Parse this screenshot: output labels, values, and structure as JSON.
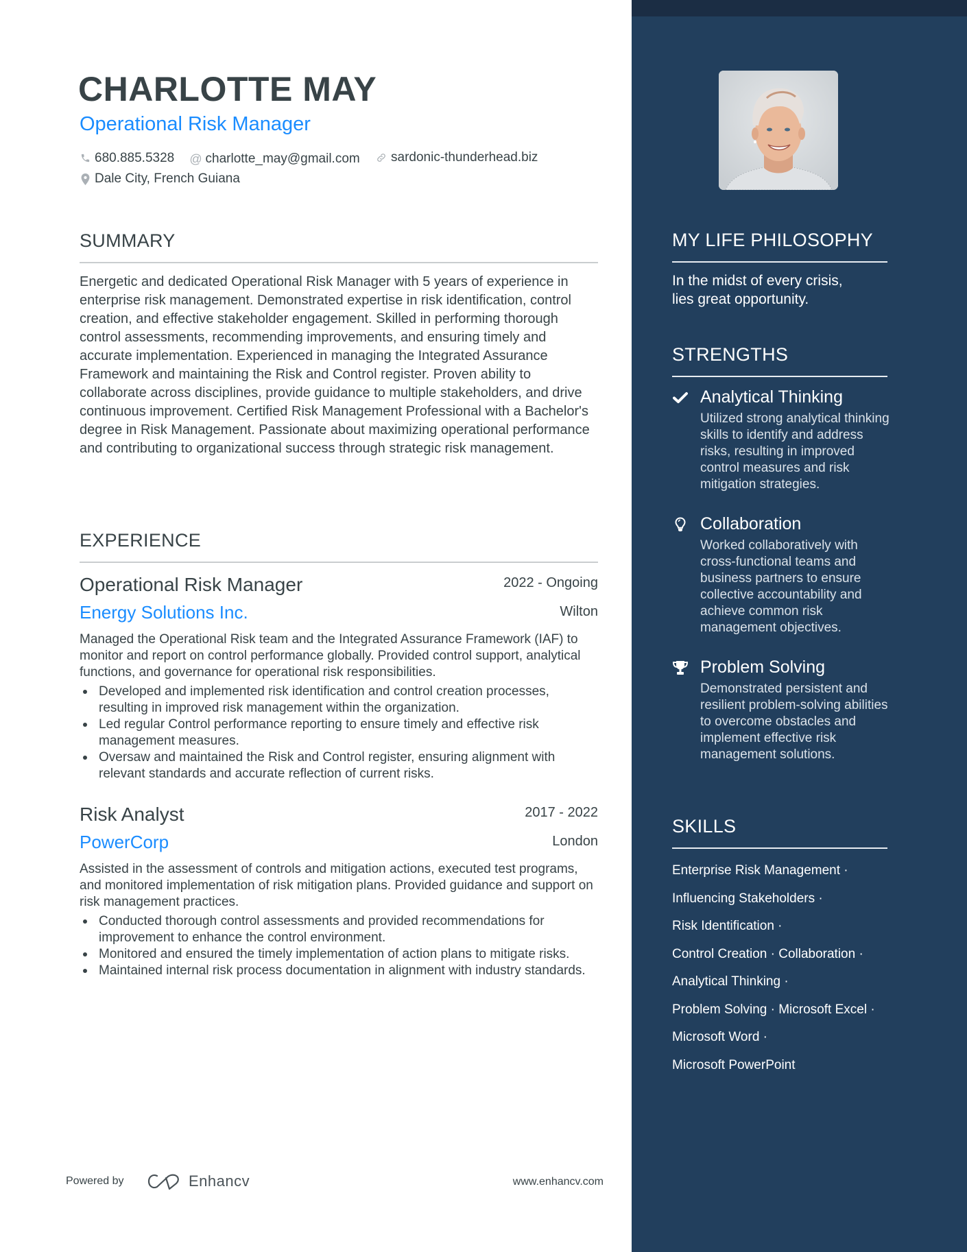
{
  "header": {
    "name": "CHARLOTTE MAY",
    "title": "Operational Risk Manager",
    "contacts": {
      "phone": "680.885.5328",
      "email": "charlotte_may@gmail.com",
      "website": "sardonic-thunderhead.biz",
      "location": "Dale City, French Guiana"
    }
  },
  "summary": {
    "heading": "SUMMARY",
    "text": "Energetic and dedicated Operational Risk Manager with 5 years of experience in enterprise risk management. Demonstrated expertise in risk identification, control creation, and effective stakeholder engagement. Skilled in performing thorough control assessments, recommending improvements, and ensuring timely and accurate implementation. Experienced in managing the Integrated Assurance Framework and maintaining the Risk and Control register. Proven ability to collaborate across disciplines, provide guidance to multiple stakeholders, and drive continuous improvement. Certified Risk Management Professional with a Bachelor's degree in Risk Management. Passionate about maximizing operational performance and contributing to organizational success through strategic risk management."
  },
  "experience": {
    "heading": "EXPERIENCE",
    "jobs": [
      {
        "title": "Operational Risk Manager",
        "dates": "2022 - Ongoing",
        "company": "Energy Solutions Inc.",
        "location": "Wilton",
        "description": "Managed the Operational Risk team and the Integrated Assurance Framework (IAF) to monitor and report on control performance globally. Provided control support, analytical functions, and governance for operational risk responsibilities.",
        "bullets": [
          "Developed and implemented risk identification and control creation processes, resulting in improved risk management within the organization.",
          "Led regular Control performance reporting to ensure timely and effective risk management measures.",
          "Oversaw and maintained the Risk and Control register, ensuring alignment with relevant standards and accurate reflection of current risks."
        ]
      },
      {
        "title": "Risk Analyst",
        "dates": "2017 - 2022",
        "company": "PowerCorp",
        "location": "London",
        "description": "Assisted in the assessment of controls and mitigation actions, executed test programs, and monitored implementation of risk mitigation plans. Provided guidance and support on risk management practices.",
        "bullets": [
          "Conducted thorough control assessments and provided recommendations for improvement to enhance the control environment.",
          "Monitored and ensured the timely implementation of action plans to mitigate risks.",
          "Maintained internal risk process documentation in alignment with industry standards."
        ]
      }
    ]
  },
  "sidebar": {
    "philosophy": {
      "heading": "MY LIFE PHILOSOPHY",
      "quote_line1": "In the midst of every crisis,",
      "quote_line2": "lies great opportunity."
    },
    "strengths": {
      "heading": "STRENGTHS",
      "items": [
        {
          "icon": "check-icon",
          "title": "Analytical Thinking",
          "description": "Utilized strong analytical thinking skills to identify and address risks, resulting in improved control measures and risk mitigation strategies."
        },
        {
          "icon": "lightbulb-icon",
          "title": "Collaboration",
          "description": "Worked collaboratively with cross-functional teams and business partners to ensure collective accountability and achieve common risk management objectives."
        },
        {
          "icon": "trophy-icon",
          "title": "Problem Solving",
          "description": "Demonstrated persistent and resilient problem-solving abilities to overcome obstacles and implement effective risk management solutions."
        }
      ]
    },
    "skills": {
      "heading": "SKILLS",
      "lines": [
        "Enterprise Risk Management ·",
        "Influencing Stakeholders ·",
        "Risk Identification ·",
        "Control Creation · Collaboration ·",
        "Analytical Thinking ·",
        "Problem Solving · Microsoft Excel ·",
        "Microsoft Word ·",
        "Microsoft PowerPoint"
      ]
    }
  },
  "footer": {
    "powered_by": "Powered by",
    "brand": "Enhancv",
    "url": "www.enhancv.com"
  },
  "colors": {
    "accent": "#1a8cff",
    "text": "#384347",
    "sidebar_bg": "#223f5d",
    "sidebar_top": "#1b2d44"
  }
}
